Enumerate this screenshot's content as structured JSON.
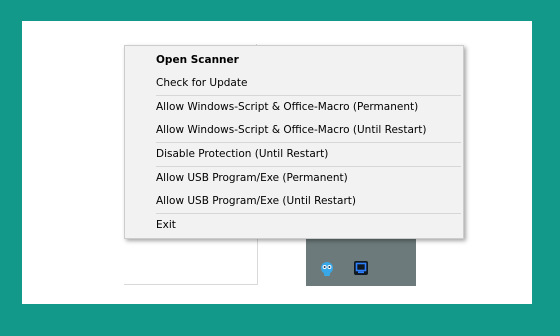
{
  "menu": {
    "groups": [
      {
        "items": [
          {
            "label": "Open Scanner",
            "bold": true
          },
          {
            "label": "Check for Update"
          }
        ]
      },
      {
        "items": [
          {
            "label": "Allow Windows-Script & Office-Macro (Permanent)"
          },
          {
            "label": "Allow Windows-Script & Office-Macro (Until Restart)"
          }
        ]
      },
      {
        "items": [
          {
            "label": "Disable Protection (Until Restart)"
          }
        ]
      },
      {
        "items": [
          {
            "label": "Allow USB Program/Exe (Permanent)"
          },
          {
            "label": "Allow USB Program/Exe (Until Restart)"
          }
        ]
      },
      {
        "items": [
          {
            "label": "Exit"
          }
        ]
      }
    ]
  },
  "tray": {
    "icons": [
      "scanner-tray-icon",
      "monitor-tray-icon"
    ]
  },
  "colors": {
    "background": "#12998a",
    "taskbar": "#6c7a7b",
    "menu_bg": "#f2f2f2",
    "scanner_icon": "#39a8e8",
    "monitor_icon": "#2f80ff"
  }
}
